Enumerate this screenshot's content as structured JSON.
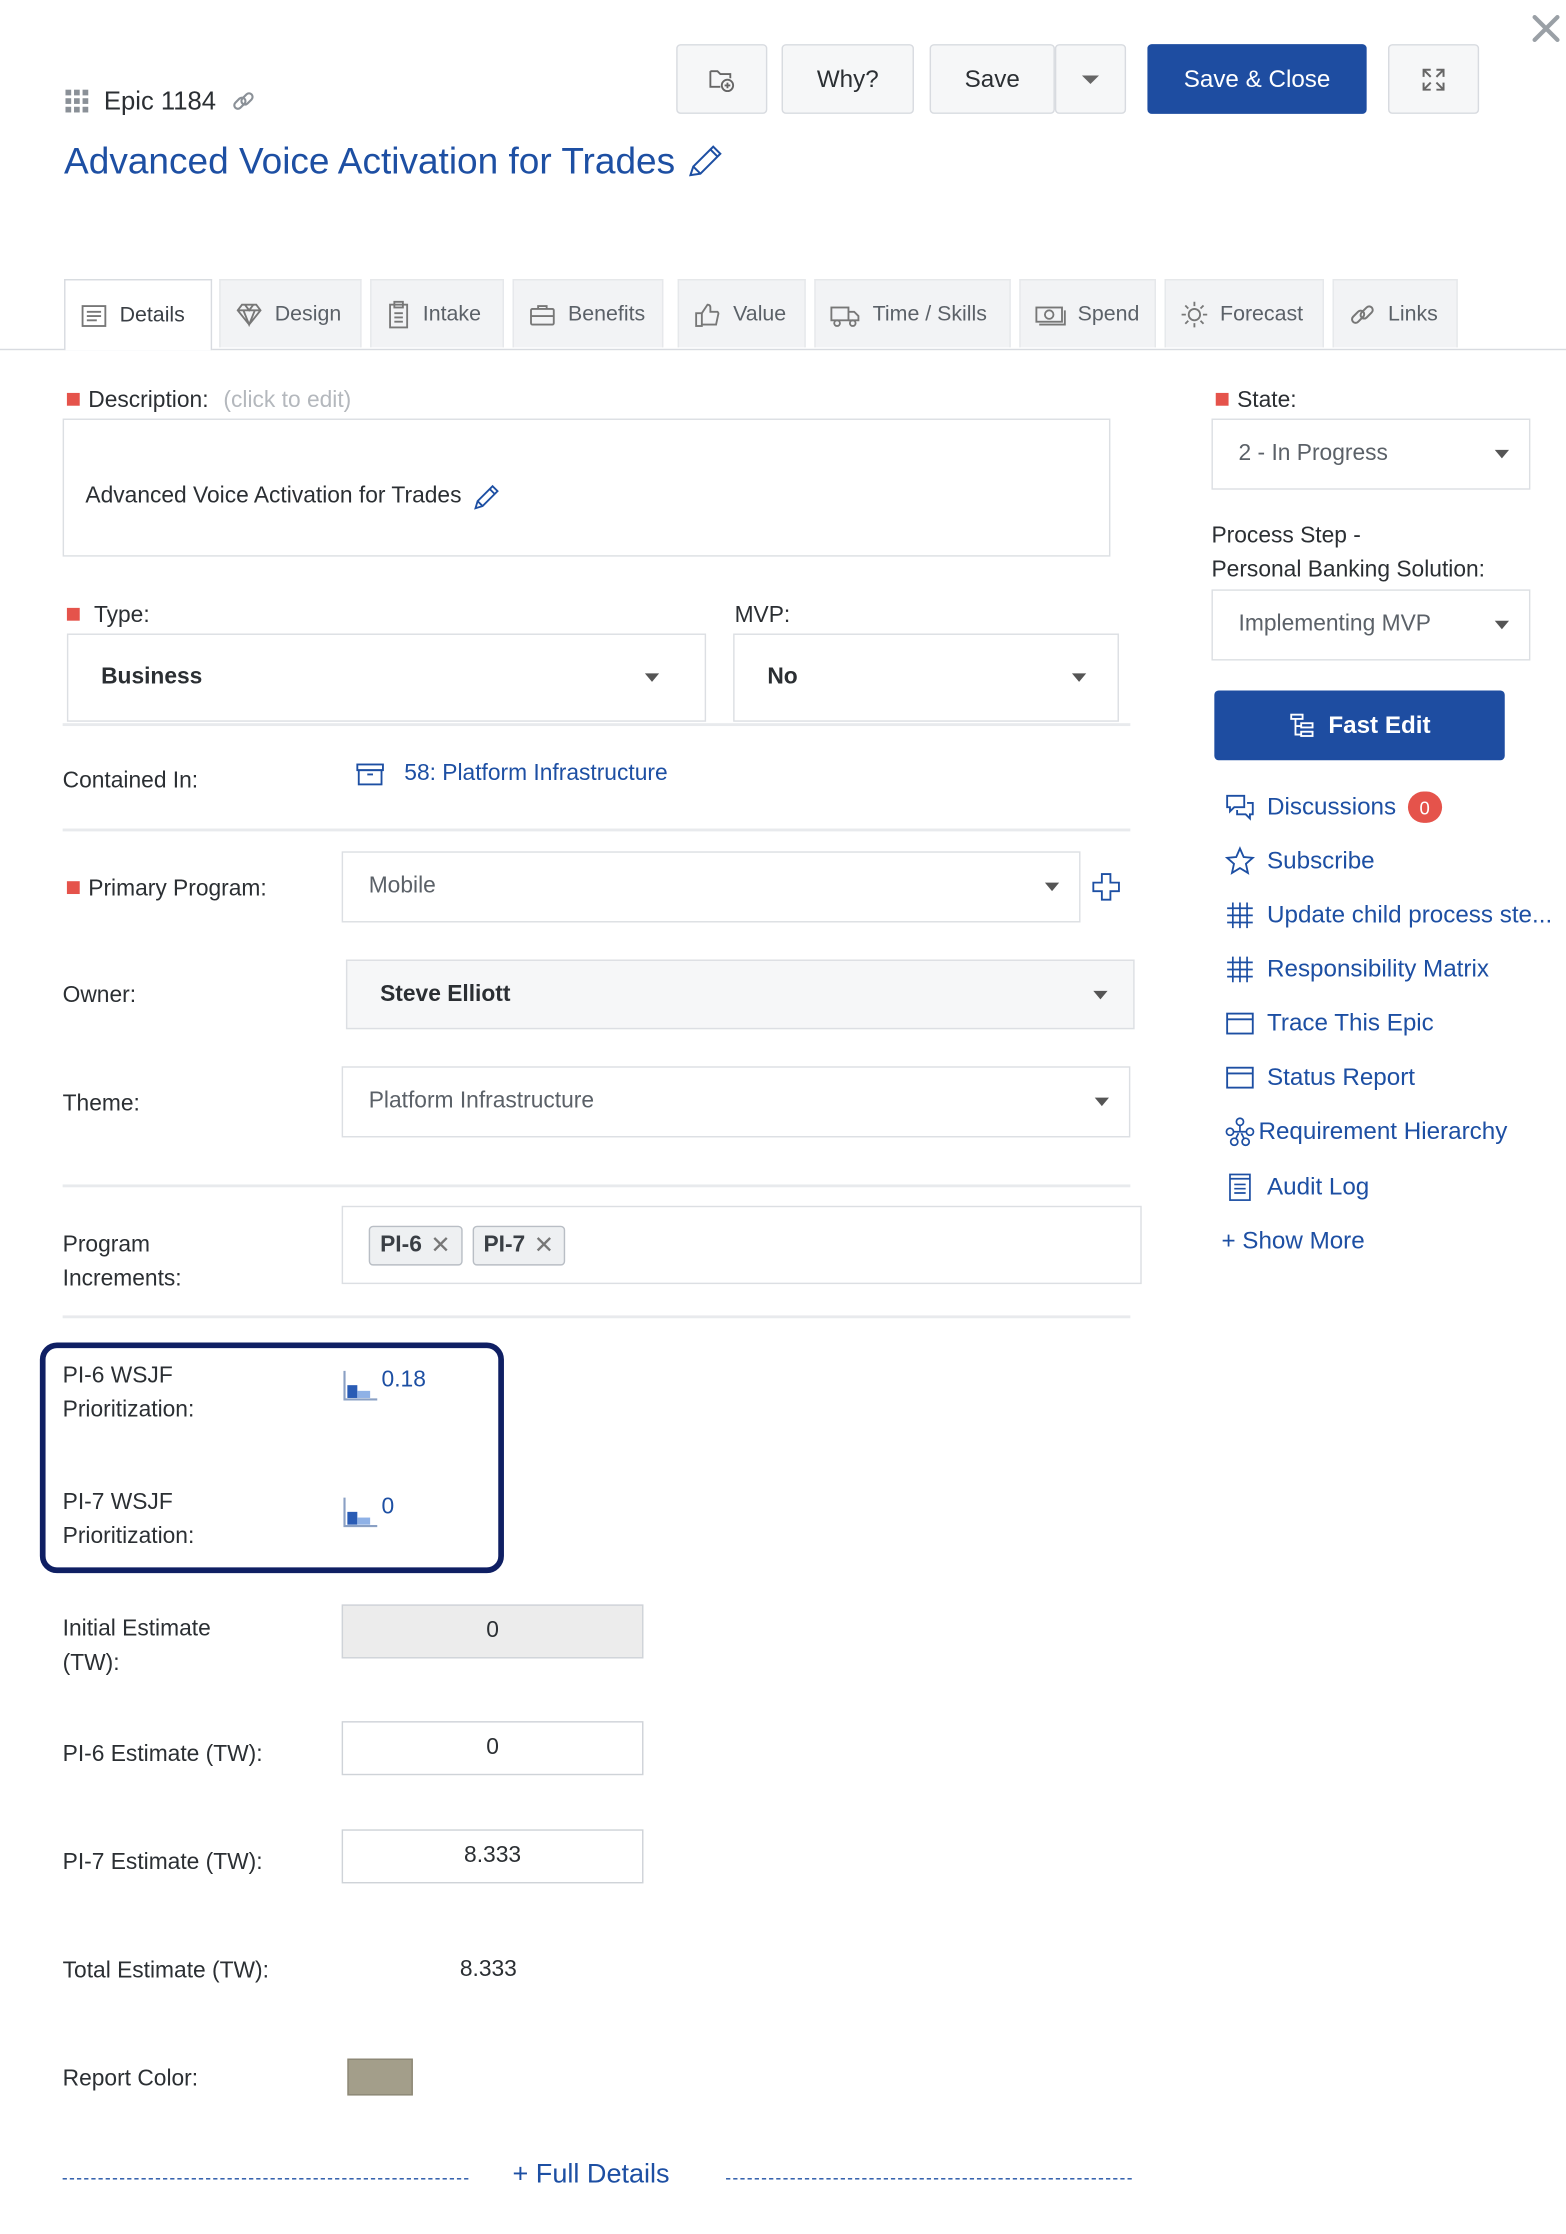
{
  "header": {
    "item_type": "Epic 1184",
    "title": "Advanced Voice Activation for Trades",
    "why_label": "Why?",
    "save_label": "Save",
    "save_close_label": "Save & Close"
  },
  "tabs": [
    {
      "label": "Details",
      "icon": "document-icon",
      "active": true
    },
    {
      "label": "Design",
      "icon": "diamond-icon"
    },
    {
      "label": "Intake",
      "icon": "clipboard-icon"
    },
    {
      "label": "Benefits",
      "icon": "briefcase-icon"
    },
    {
      "label": "Value",
      "icon": "thumbs-up-icon"
    },
    {
      "label": "Time / Skills",
      "icon": "truck-icon"
    },
    {
      "label": "Spend",
      "icon": "money-icon"
    },
    {
      "label": "Forecast",
      "icon": "sun-icon"
    },
    {
      "label": "Links",
      "icon": "link-icon"
    }
  ],
  "form": {
    "description_label": "Description:",
    "description_hint": "(click to edit)",
    "description_text": "Advanced Voice Activation for Trades",
    "type_label": "Type:",
    "type_value": "Business",
    "mvp_label": "MVP:",
    "mvp_value": "No",
    "contained_label": "Contained In:",
    "contained_value": "58: Platform Infrastructure",
    "primary_program_label": "Primary Program:",
    "primary_program_value": "Mobile",
    "owner_label": "Owner:",
    "owner_value": "Steve Elliott",
    "theme_label": "Theme:",
    "theme_value": "Platform Infrastructure",
    "pi_label_1": "Program",
    "pi_label_2": "Increments:",
    "program_increments": [
      "PI-6",
      "PI-7"
    ],
    "wsjf": [
      {
        "label_1": "PI-6 WSJF",
        "label_2": "Prioritization:",
        "value": "0.18"
      },
      {
        "label_1": "PI-7 WSJF",
        "label_2": "Prioritization:",
        "value": "0"
      }
    ],
    "initial_estimate_label_1": "Initial Estimate",
    "initial_estimate_label_2": "(TW):",
    "initial_estimate_value": "0",
    "pi6_estimate_label": "PI-6 Estimate (TW):",
    "pi6_estimate_value": "0",
    "pi7_estimate_label": "PI-7 Estimate (TW):",
    "pi7_estimate_value": "8.333",
    "total_estimate_label": "Total Estimate (TW):",
    "total_estimate_value": "8.333",
    "report_color_label": "Report Color:",
    "report_color": "#a39e8a",
    "full_details_label": "+ Full Details"
  },
  "sidebar": {
    "state_label": "State:",
    "state_value": "2 - In Progress",
    "process_step_label_1": "Process Step -",
    "process_step_label_2": "Personal Banking Solution:",
    "process_step_value": "Implementing MVP",
    "fast_edit_label": "Fast Edit",
    "discussions_count": "0",
    "items": [
      {
        "label": "Discussions",
        "icon": "discussion-icon"
      },
      {
        "label": "Subscribe",
        "icon": "star-icon"
      },
      {
        "label": "Update child process ste...",
        "icon": "grid-icon"
      },
      {
        "label": "Responsibility Matrix",
        "icon": "grid-icon"
      },
      {
        "label": "Trace This Epic",
        "icon": "window-icon"
      },
      {
        "label": "Status Report",
        "icon": "window-icon"
      },
      {
        "label": "Requirement Hierarchy",
        "icon": "hierarchy-icon"
      },
      {
        "label": "Audit Log",
        "icon": "log-icon"
      }
    ],
    "show_more_label": "+ Show More"
  },
  "colors": {
    "primary": "#1e4da1",
    "link": "#1d4fa3",
    "required": "#e5534b",
    "highlight_border": "#0f1f63",
    "badge": "#e5534b"
  }
}
